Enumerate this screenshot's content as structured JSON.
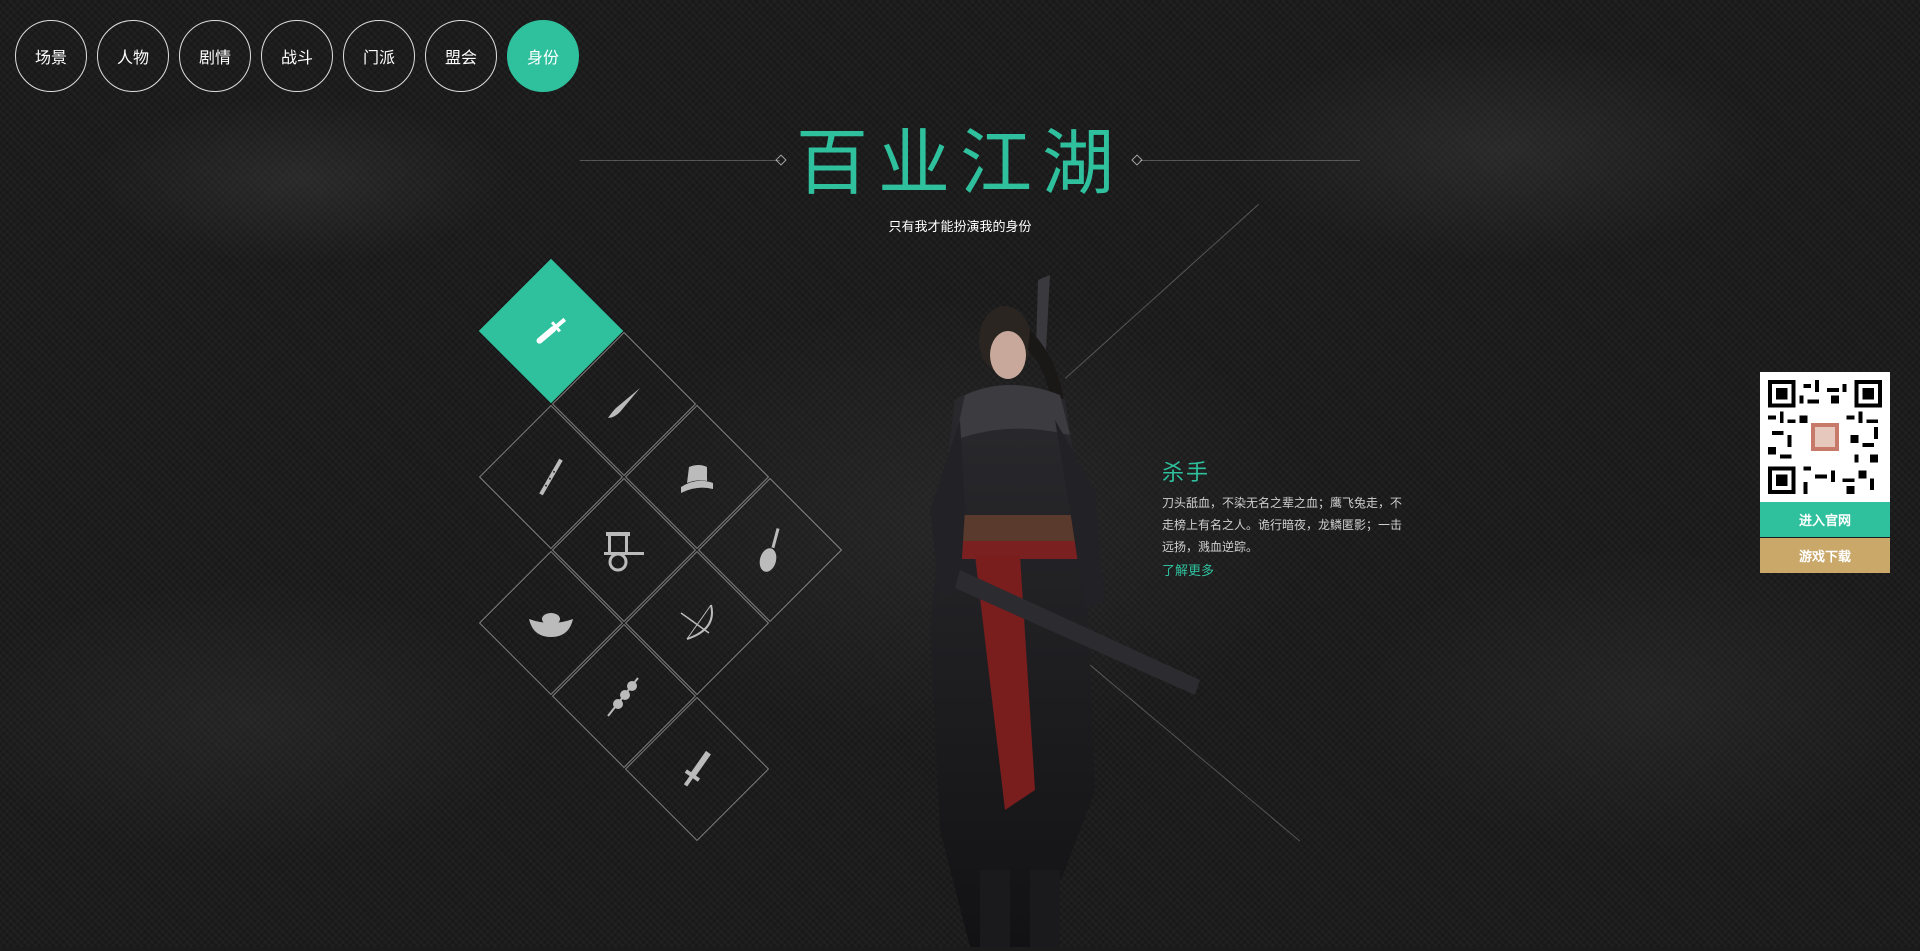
{
  "nav": {
    "items": [
      {
        "label": "场景",
        "active": false
      },
      {
        "label": "人物",
        "active": false
      },
      {
        "label": "剧情",
        "active": false
      },
      {
        "label": "战斗",
        "active": false
      },
      {
        "label": "门派",
        "active": false
      },
      {
        "label": "盟会",
        "active": false
      },
      {
        "label": "身份",
        "active": true
      }
    ]
  },
  "header": {
    "title": "百业江湖",
    "subtitle": "只有我才能扮演我的身份"
  },
  "identities": {
    "icons": [
      "dagger-icon",
      "brush-icon",
      "flute-icon",
      "hat-icon",
      "cart-icon",
      "pipa-icon",
      "ingot-icon",
      "bow-icon",
      "skewer-icon",
      "short-sword-icon"
    ],
    "selected": "dagger-icon"
  },
  "role": {
    "name": "杀手",
    "description": "刀头舐血，不染无名之辈之血；鹰飞兔走，不走榜上有名之人。诡行暗夜，龙鳞匿影；一击远扬，溅血逆踪。",
    "more_label": "了解更多"
  },
  "sidebar": {
    "site_label": "进入官网",
    "download_label": "游戏下载"
  },
  "colors": {
    "accent": "#2fc09d",
    "gold": "#c9a86a",
    "background": "#1c1c1c"
  }
}
